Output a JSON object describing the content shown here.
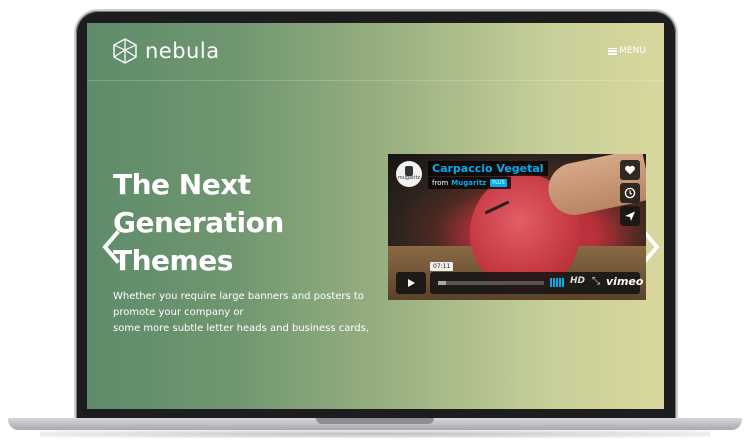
{
  "brand": {
    "name": "nebula",
    "logo_icon": "geodesic-polygon-icon"
  },
  "header": {
    "menu_label": "MENU",
    "menu_icon": "hamburger-icon"
  },
  "hero": {
    "title_lines": [
      "The Next",
      "Generation",
      "Themes"
    ],
    "description_lines": [
      "Whether you require large banners and posters to",
      "promote your company or",
      "some more subtle letter heads and business cards,"
    ]
  },
  "slider": {
    "prev_icon": "chevron-left-icon",
    "next_icon": "chevron-right-icon"
  },
  "video": {
    "title": "Carpaccio Vegetal",
    "from_label": "from",
    "author": "Mugaritz",
    "author_badge": "PLUS",
    "channel_badge": "mugaritz",
    "time": "07:11",
    "progress": 0.08,
    "quality": "HD",
    "provider": "vimeo",
    "side_icons": [
      "heart-icon",
      "clock-icon",
      "send-icon"
    ]
  },
  "colors": {
    "gradient_start": "#5e8c6a",
    "gradient_end": "#d9d79e",
    "vimeo_blue": "#00adef"
  }
}
